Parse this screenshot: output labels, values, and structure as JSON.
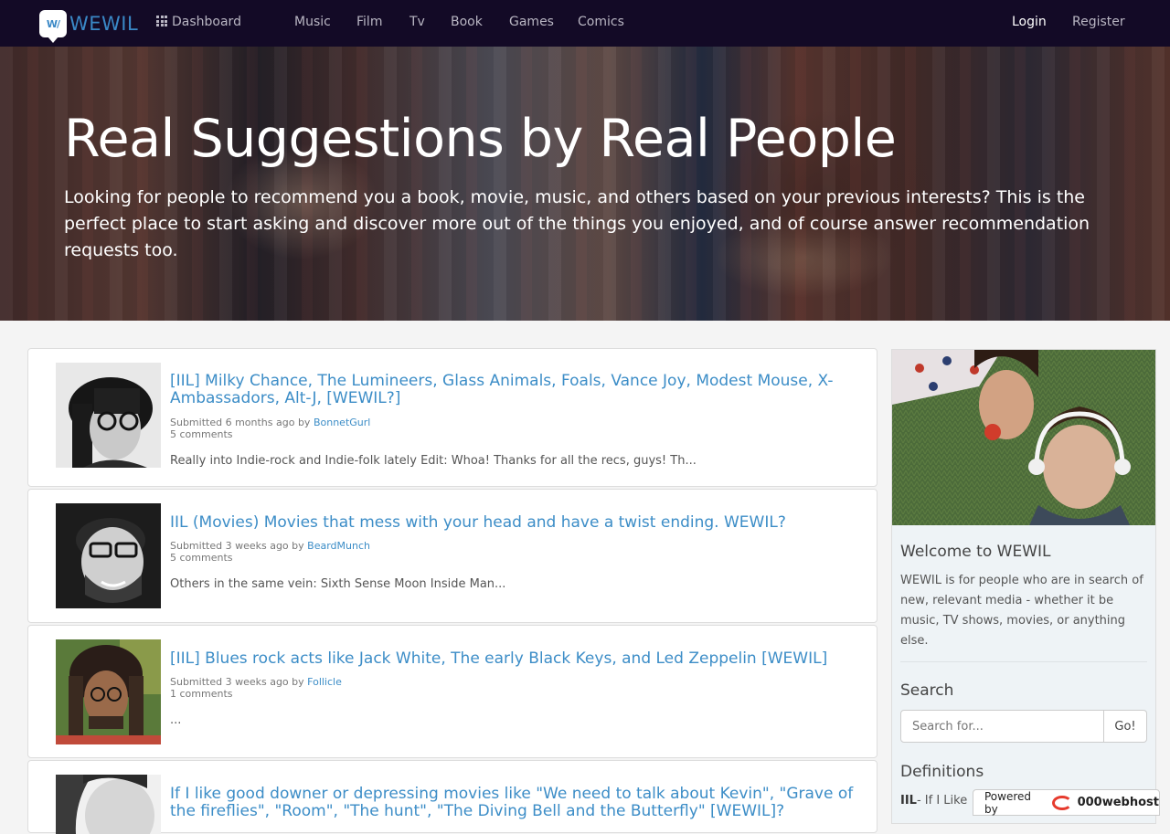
{
  "nav": {
    "logo_mark": "W/",
    "logo_text": "WEWIL",
    "dashboard": "Dashboard",
    "links": [
      "Music",
      "Film",
      "Tv",
      "Book",
      "Games",
      "Comics"
    ],
    "login": "Login",
    "register": "Register"
  },
  "hero": {
    "title": "Real Suggestions by Real People",
    "subtitle": "Looking for people to recommend you a book, movie, music, and others based on your previous interests? This is the perfect place to start asking and discover more out of the things you enjoyed, and of course answer recommendation requests too."
  },
  "posts": [
    {
      "title": "[IIL] Milky Chance, The Lumineers, Glass Animals, Foals, Vance Joy, Modest Mouse, X-Ambassadors, Alt-J, [WEWIL?]",
      "submitted": "Submitted 6 months ago by ",
      "user": "BonnetGurl",
      "comments": "5 comments",
      "excerpt": "Really into Indie-rock and Indie-folk lately Edit: Whoa! Thanks for all the recs, guys! Th..."
    },
    {
      "title": "IIL (Movies) Movies that mess with your head and have a twist ending. WEWIL?",
      "submitted": "Submitted 3 weeks ago by ",
      "user": "BeardMunch",
      "comments": "5 comments",
      "excerpt": "Others in the same vein: Sixth Sense Moon Inside Man..."
    },
    {
      "title": "[IIL] Blues rock acts like Jack White, The early Black Keys, and Led Zeppelin [WEWIL]",
      "submitted": "Submitted 3 weeks ago by ",
      "user": "Follicle",
      "comments": "1 comments",
      "excerpt": "..."
    },
    {
      "title": "If I like good downer or depressing movies like \"We need to talk about Kevin\", \"Grave of the fireflies\", \"Room\", \"The hunt\", \"The Diving Bell and the Butterfly\" [WEWIL]?"
    }
  ],
  "sidebar": {
    "welcome_title": "Welcome to WEWIL",
    "welcome_text": "WEWIL is for people who are in search of new, relevant media - whether it be music, TV shows, movies, or anything else.",
    "search_title": "Search",
    "search_placeholder": "Search for...",
    "search_button": "Go!",
    "definitions_title": "Definitions",
    "definition_term": "IIL",
    "definition_text": "- If I Like"
  },
  "footer": {
    "powered_by": "Powered by",
    "host": "000webhost"
  },
  "colors": {
    "nav_bg": "#130a26",
    "link_blue": "#3c8dc7",
    "logo_blue": "#3a88c6"
  }
}
